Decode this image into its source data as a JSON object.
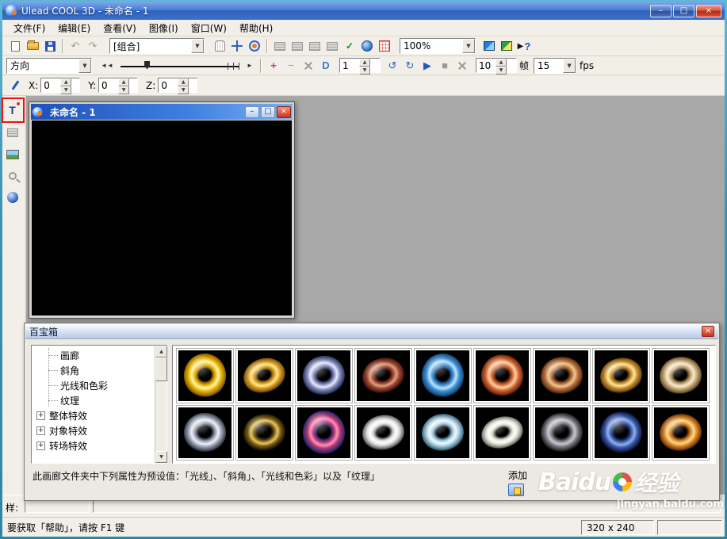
{
  "window": {
    "title": "Ulead COOL 3D - 未命名 - 1"
  },
  "window_controls": {
    "minimize": "–",
    "maximize": "□",
    "close": "×"
  },
  "menu": {
    "items": [
      "文件(F)",
      "编辑(E)",
      "查看(V)",
      "图像(I)",
      "窗口(W)",
      "帮助(H)"
    ]
  },
  "toolbars": {
    "group_combo": "[组合]",
    "zoom_combo": "100%",
    "direction_combo": "方向",
    "keyframe_value": "1",
    "frames_value": "10",
    "frames_unit": "帧",
    "fps_value": "15",
    "fps_unit": "fps",
    "x_label": "X:",
    "x_value": "0",
    "y_label": "Y:",
    "y_value": "0",
    "z_label": "Z:",
    "z_value": "0"
  },
  "icons": {
    "undo": "↶",
    "redo": "↷",
    "dropdown": "▼",
    "up": "▲",
    "down": "▼",
    "rotate_left": "↺",
    "rotate_right": "↻",
    "play": "▶",
    "stop": "■",
    "add_object": "+",
    "remove_object": "−",
    "bevel": "D",
    "insert_text": "T",
    "help_arrow": "▶",
    "help_q": "?",
    "left_arrows": "◄◄",
    "right_arrows": "►",
    "check": "✓",
    "tree_expand": "+"
  },
  "child_window": {
    "title": "未命名 - 1"
  },
  "toolbox": {
    "title": "百宝箱",
    "tree": [
      {
        "label": "画廊"
      },
      {
        "label": "斜角"
      },
      {
        "label": "光线和色彩"
      },
      {
        "label": "纹理"
      },
      {
        "label": "整体特效"
      },
      {
        "label": "对象特效"
      },
      {
        "label": "转场特效"
      }
    ],
    "description": "此画廊文件夹中下列属性为预设值：「光线」、「斜角」、「光线和色彩」以及「纹理」",
    "add_label": "添加",
    "thumbnails": [
      {
        "c": "#e8b400",
        "h": "#fff4b0",
        "d": "#8a6000",
        "tilt": 0,
        "sq": 1
      },
      {
        "c": "#d89c20",
        "h": "#ffe890",
        "d": "#7a5410",
        "tilt": -18,
        "sq": 0.78
      },
      {
        "c": "#8088b8",
        "h": "#e8ecff",
        "d": "#303860",
        "tilt": -12,
        "sq": 0.9
      },
      {
        "c": "#9a4630",
        "h": "#e0a080",
        "d": "#481810",
        "tilt": -15,
        "sq": 0.8
      },
      {
        "c": "#3c8fd0",
        "h": "#bfe4ff",
        "d": "#164a80",
        "tilt": 0,
        "sq": 1
      },
      {
        "c": "#d06838",
        "h": "#ffd0a0",
        "d": "#702808",
        "tilt": 0,
        "sq": 0.95
      },
      {
        "c": "#b87040",
        "h": "#f0c890",
        "d": "#5c3010",
        "tilt": -10,
        "sq": 0.85
      },
      {
        "c": "#c89030",
        "h": "#ffe8a0",
        "d": "#6a4810",
        "tilt": -12,
        "sq": 0.8
      },
      {
        "c": "#c8a878",
        "h": "#f8ecd0",
        "d": "#6a5430",
        "tilt": -8,
        "sq": 0.85
      },
      {
        "c": "#9aa2b2",
        "h": "#eef2f8",
        "d": "#3a4250",
        "tilt": 0,
        "sq": 0.9
      },
      {
        "c": "#7a5c18",
        "h": "#e8c860",
        "d": "#201808",
        "tilt": -10,
        "sq": 0.85
      },
      {
        "c": "#b03868",
        "h": "#ff90c0",
        "d": "#282878",
        "tilt": 0,
        "sq": 1
      },
      {
        "c": "#d8d8d8",
        "h": "#ffffff",
        "d": "#606060",
        "tilt": -10,
        "sq": 0.8
      },
      {
        "c": "#a8cce0",
        "h": "#f0faff",
        "d": "#406880",
        "tilt": -8,
        "sq": 0.85
      },
      {
        "c": "#dcdcd0",
        "h": "#ffffff",
        "d": "#707068",
        "tilt": -15,
        "sq": 0.72
      },
      {
        "c": "#787880",
        "h": "#c8c8d0",
        "d": "#242428",
        "tilt": -5,
        "sq": 0.9
      },
      {
        "c": "#3858a8",
        "h": "#90b0e8",
        "d": "#101840",
        "tilt": 0,
        "sq": 0.95
      },
      {
        "c": "#d88828",
        "h": "#ffd890",
        "d": "#703808",
        "tilt": -10,
        "sq": 0.85
      }
    ]
  },
  "style_strip": {
    "label": "样:"
  },
  "statusbar": {
    "help": "要获取「帮助」，请按 F1 键",
    "size": "320 x 240"
  },
  "watermark": {
    "brand": "Baidu",
    "suffix": "经验",
    "url": "jingyan.baidu.com"
  },
  "colors": {
    "titlebar_blue": "#3a6fc8",
    "close_red": "#cc3418",
    "annotation_red": "#ee1111",
    "workspace_gray": "#a8a8a8",
    "panel_bg": "#ece9e2",
    "thumb_bg": "#000000"
  }
}
